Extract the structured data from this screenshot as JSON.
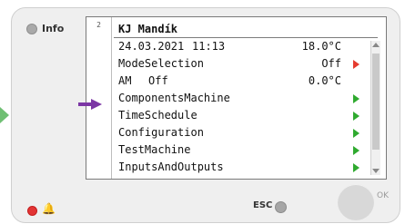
{
  "panel": {
    "info_label": "Info",
    "page_number": "2",
    "esc_label": "ESC",
    "ok_label": "OK"
  },
  "screen": {
    "title": "KJ Mandík",
    "status": {
      "date": "24.03.2021",
      "time": "11:13",
      "temperature": "18.0°C"
    },
    "rows": [
      {
        "label": "ModeSelection",
        "value": "Off",
        "arrow": "red"
      },
      {
        "label": "AM",
        "extra": "Off",
        "value": "0.0°C"
      },
      {
        "label": "ComponentsMachine",
        "arrow": "green"
      },
      {
        "label": "TimeSchedule",
        "arrow": "green"
      },
      {
        "label": "Configuration",
        "arrow": "green"
      },
      {
        "label": "TestMachine",
        "arrow": "green"
      },
      {
        "label": "InputsAndOutputs",
        "arrow": "green"
      }
    ]
  },
  "icons": {
    "bell": "bell-icon",
    "arrow": "pointer-arrow-icon"
  },
  "colors": {
    "panel_bg": "#efefef",
    "screen_bg": "#ffffff",
    "arrow_green": "#2faa2f",
    "arrow_red": "#e53b2f",
    "pointer": "#7b36a4",
    "alarm_dot": "#e23434"
  }
}
